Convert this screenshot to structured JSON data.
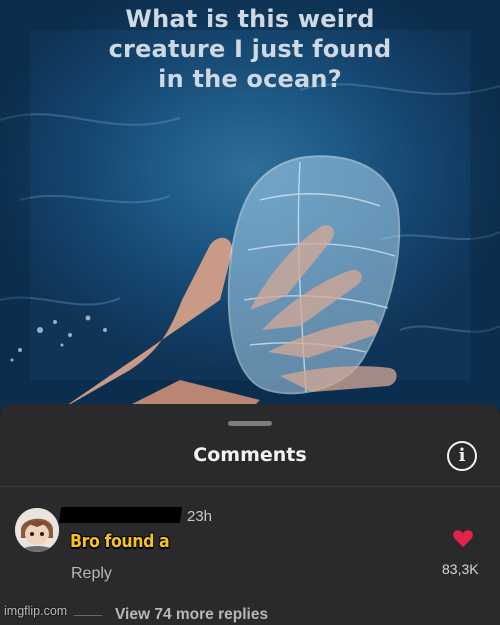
{
  "post": {
    "caption_lines": [
      "What is this weird",
      "creature I just found",
      "in the ocean?"
    ]
  },
  "comments_sheet": {
    "title": "Comments",
    "info_icon": "info-icon",
    "comment": {
      "timestamp": "23h",
      "text": "Bro found a",
      "reply_label": "Reply",
      "like_icon": "heart-icon",
      "like_color": "#e0244a",
      "like_count": "83,3K"
    },
    "view_replies_label": "View 74 more replies"
  },
  "watermark": "imgflip.com"
}
